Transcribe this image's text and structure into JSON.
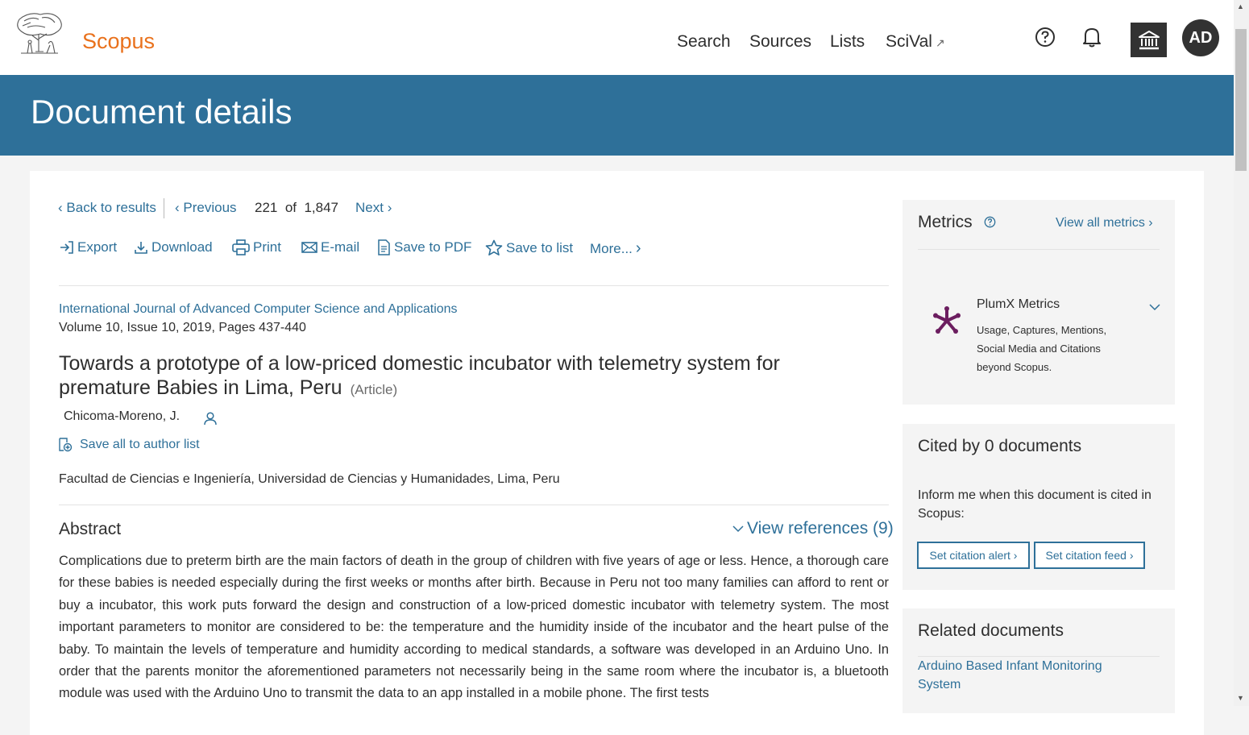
{
  "header": {
    "brand": "Scopus",
    "nav": [
      {
        "label": "Search"
      },
      {
        "label": "Sources"
      },
      {
        "label": "Lists"
      },
      {
        "label": "SciVal",
        "ext": "↗"
      }
    ],
    "avatar_initials": "AD"
  },
  "banner": {
    "title": "Document details"
  },
  "pager": {
    "back": "Back to results",
    "previous": "Previous",
    "current": "221",
    "of": "of",
    "total": "1,847",
    "next": "Next"
  },
  "tools": {
    "export": "Export",
    "download": "Download",
    "print": "Print",
    "email": "E-mail",
    "save_pdf": "Save to PDF",
    "save_list": "Save to list",
    "more": "More..."
  },
  "document": {
    "source": "International Journal of Advanced Computer Science and Applications",
    "volume": "Volume 10, Issue 10, 2019, Pages 437-440",
    "title": "Towards a prototype of a low-priced domestic incubator with telemetry system for premature Babies in Lima, Peru",
    "type": "(Article)",
    "author": "Chicoma-Moreno, J.",
    "save_author": "Save all to author list",
    "affiliation": "Facultad de Ciencias e Ingeniería, Universidad de Ciencias y Humanidades, Lima, Peru"
  },
  "abstract": {
    "heading": "Abstract",
    "view_refs": "View references (9)",
    "text": "Complications due to preterm birth are the main factors of death in the group of children with five years of age or less. Hence, a thorough care for these babies is needed especially during the first weeks or months after birth. Because in Peru not too many families can afford to rent or buy a incubator, this work puts forward the design and construction of a low-priced domestic incubator with telemetry system. The most important parameters to monitor are considered to be: the temperature and the humidity inside of the incubator and the heart pulse of the baby. To maintain the levels of temperature and humidity according to medical standards, a software was developed in an Arduino Uno. In order that the parents monitor the aforementioned parameters not necessarily being in the same room where the incubator is, a bluetooth module was used with the Arduino Uno to transmit the data to an app installed in a mobile phone. The first tests"
  },
  "metrics": {
    "title": "Metrics",
    "view_all": "View all metrics",
    "plumx_title": "PlumX Metrics",
    "plumx_desc": "Usage, Captures, Mentions, Social Media and Citations beyond Scopus."
  },
  "cited": {
    "title": "Cited by 0 documents",
    "inform": "Inform me when this document is cited in Scopus:",
    "set_alert": "Set citation alert",
    "set_feed": "Set citation feed"
  },
  "related": {
    "title": "Related documents",
    "first": "Arduino Based Infant Monitoring System"
  },
  "colors": {
    "brand": "#e9711c",
    "primary": "#2e7099",
    "banner": "#2e7099",
    "text": "#2e2e2e"
  }
}
